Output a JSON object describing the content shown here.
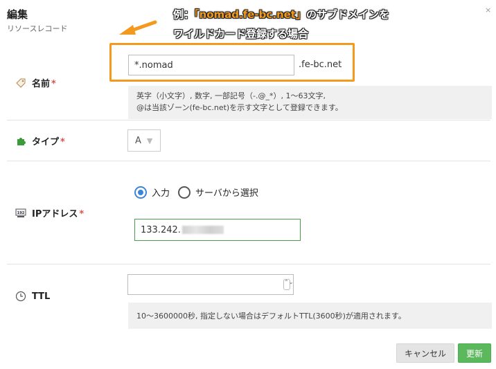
{
  "dialog": {
    "title": "編集",
    "subtitle": "リソースレコード",
    "close_label": "×"
  },
  "annotation": {
    "line1_prefix": "例：",
    "line1_highlight": "「nomad.fe-bc.net」",
    "line1_suffix": "のサブドメインを",
    "line2": "ワイルドカード登録する場合",
    "color": "#f39a1e"
  },
  "name_field": {
    "label": "名前",
    "required_mark": "*",
    "icon": "tag-icon",
    "value": "*.nomad",
    "suffix": ".fe-bc.net",
    "help_line1": "英字（小文字）, 数字, 一部記号（-.@_*）, 1〜63文字,",
    "help_line2": "@は当該ゾーン(fe-bc.net)を示す文字として登録できます。"
  },
  "type_field": {
    "label": "タイプ",
    "required_mark": "*",
    "icon": "puzzle-icon",
    "value": "A",
    "caret": "▼"
  },
  "ip_field": {
    "label": "IPアドレス",
    "required_mark": "*",
    "icon": "network-icon",
    "radio_input": "入力",
    "radio_select": "サーバから選択",
    "value_visible": "133.242."
  },
  "ttl_field": {
    "label": "TTL",
    "icon": "clock-icon",
    "value": "",
    "spinner": "⌃⌄",
    "help": "10〜3600000秒, 指定しない場合はデフォルトTTL(3600秒)が適用されます。"
  },
  "buttons": {
    "cancel": "キャンセル",
    "update": "更新"
  },
  "colors": {
    "accent_orange": "#f39a1e",
    "update_green": "#5cb85c",
    "radio_blue": "#3a86d6",
    "required_red": "#d9534f"
  }
}
